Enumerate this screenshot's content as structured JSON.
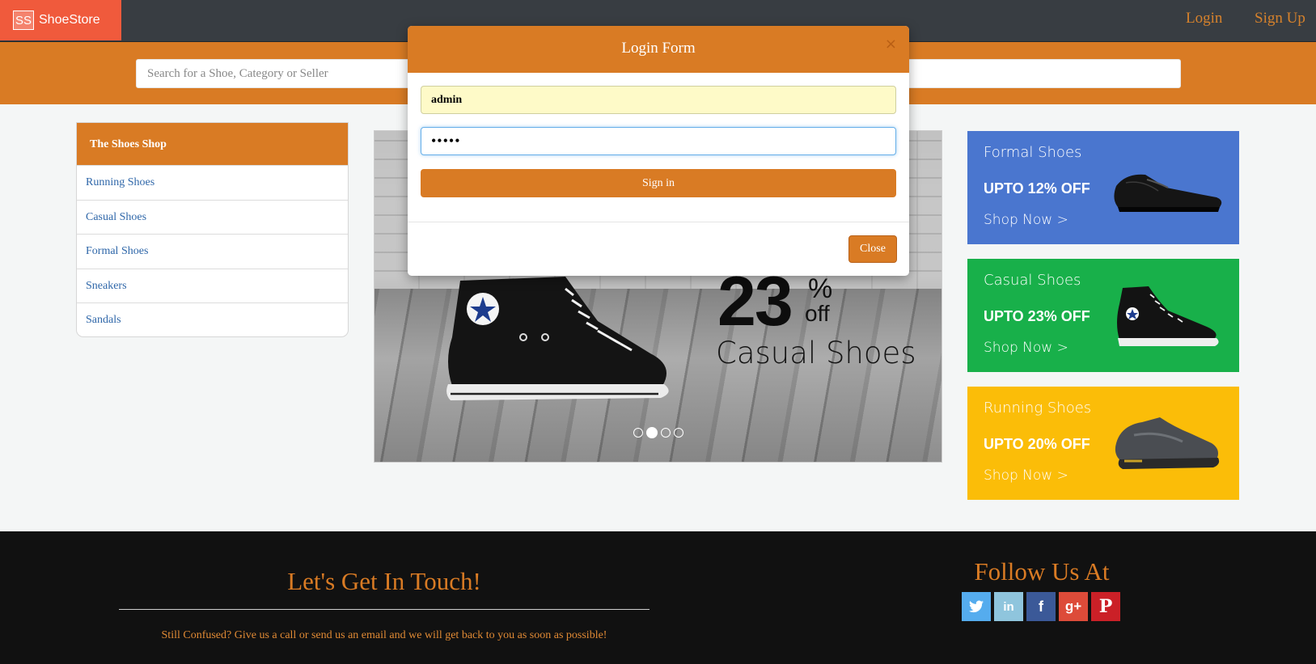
{
  "navbar": {
    "brand_logo": "SS",
    "brand_name": "ShoeStore",
    "login_label": "Login",
    "signup_label": "Sign Up"
  },
  "search": {
    "placeholder": "Search for a Shoe, Category or Seller",
    "value": ""
  },
  "sidebar": {
    "title": "The Shoes Shop",
    "items": [
      {
        "label": "Running Shoes"
      },
      {
        "label": "Casual Shoes"
      },
      {
        "label": "Formal Shoes"
      },
      {
        "label": "Sneakers"
      },
      {
        "label": "Sandals"
      }
    ]
  },
  "slider": {
    "promo_number": "23",
    "promo_percent": "%",
    "promo_off": "off",
    "promo_category": "Casual Shoes",
    "slide_count": 4,
    "active_slide": 2
  },
  "promos": [
    {
      "title": "Formal Shoes",
      "deal": "UPTO 12% OFF",
      "cta": "Shop Now >",
      "color": "#4a76cf",
      "icon": "formal-shoe-icon"
    },
    {
      "title": "Casual Shoes",
      "deal": "UPTO 23% OFF",
      "cta": "Shop Now >",
      "color": "#18b04a",
      "icon": "casual-shoe-icon"
    },
    {
      "title": "Running Shoes",
      "deal": "UPTO 20% OFF",
      "cta": "Shop Now >",
      "color": "#fbbd08",
      "icon": "running-shoe-icon"
    }
  ],
  "footer": {
    "touch_title": "Let's Get In Touch!",
    "touch_text": "Still Confused? Give us a call or send us an email and we will get back to you as soon as possible!",
    "follow_title": "Follow Us At",
    "social": [
      {
        "name": "twitter-icon",
        "glyph": "🐦",
        "color": "#55acee"
      },
      {
        "name": "linkedin-icon",
        "glyph": "in",
        "color": "#8fc5dd"
      },
      {
        "name": "facebook-icon",
        "glyph": "f",
        "color": "#3b5998"
      },
      {
        "name": "google-plus-icon",
        "glyph": "g+",
        "color": "#dd4b39"
      },
      {
        "name": "pinterest-icon",
        "glyph": "P",
        "color": "#cb2027"
      }
    ]
  },
  "modal": {
    "title": "Login Form",
    "close_x": "×",
    "username_value": "admin",
    "password_value": "•••••",
    "signin_label": "Sign in",
    "close_label": "Close"
  },
  "colors": {
    "accent": "#d97b24",
    "navbar": "#383d42",
    "brand": "#f05a3c",
    "footer": "#111111"
  }
}
